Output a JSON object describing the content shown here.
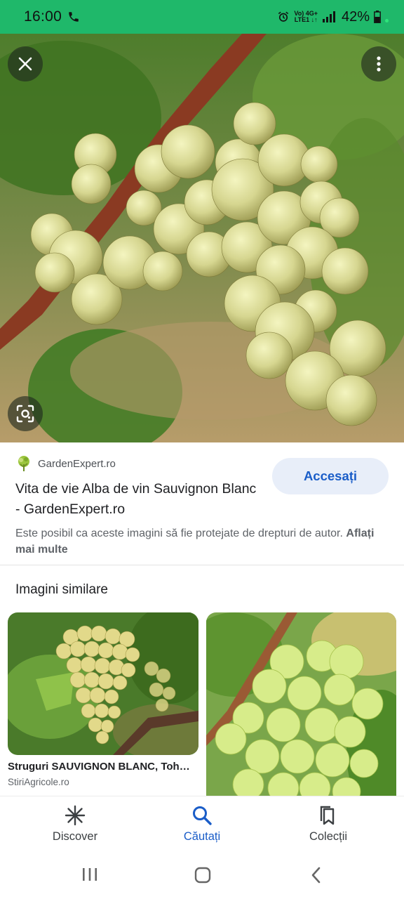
{
  "status_bar": {
    "time": "16:00",
    "net_line1": "Vo) 4G+",
    "net_line2": "LTE1 ↓↑",
    "battery": "42%",
    "icons": [
      "call-icon",
      "alarm-icon",
      "signal-icon",
      "battery-icon"
    ]
  },
  "hero": {
    "icons": [
      "close-icon",
      "more-vert-icon",
      "lens-icon"
    ]
  },
  "info": {
    "source_name": "GardenExpert.ro",
    "title": "Vita de vie Alba de vin Sauvignon Blanc - GardenExpert.ro",
    "visit_label": "Accesați",
    "copyright_text": "Este posibil ca aceste imagini să fie protejate de drepturi de autor.",
    "learn_more": "Aflați mai multe"
  },
  "similar": {
    "heading": "Imagini similare",
    "items": [
      {
        "title": "Struguri SAUVIGNON BLANC, Tohanu Nou, Brașov",
        "source": "StiriAgricole.ro"
      },
      {
        "title": "",
        "source": ""
      }
    ]
  },
  "bottom_nav": {
    "items": [
      {
        "label": "Discover",
        "icon": "asterisk-icon",
        "active": false
      },
      {
        "label": "Căutați",
        "icon": "search-icon",
        "active": true
      },
      {
        "label": "Colecții",
        "icon": "bookmarks-icon",
        "active": false
      }
    ]
  },
  "colors": {
    "status_bar": "#1fb86a",
    "accent": "#1a5dc8",
    "button_bg": "#e8eef9"
  }
}
